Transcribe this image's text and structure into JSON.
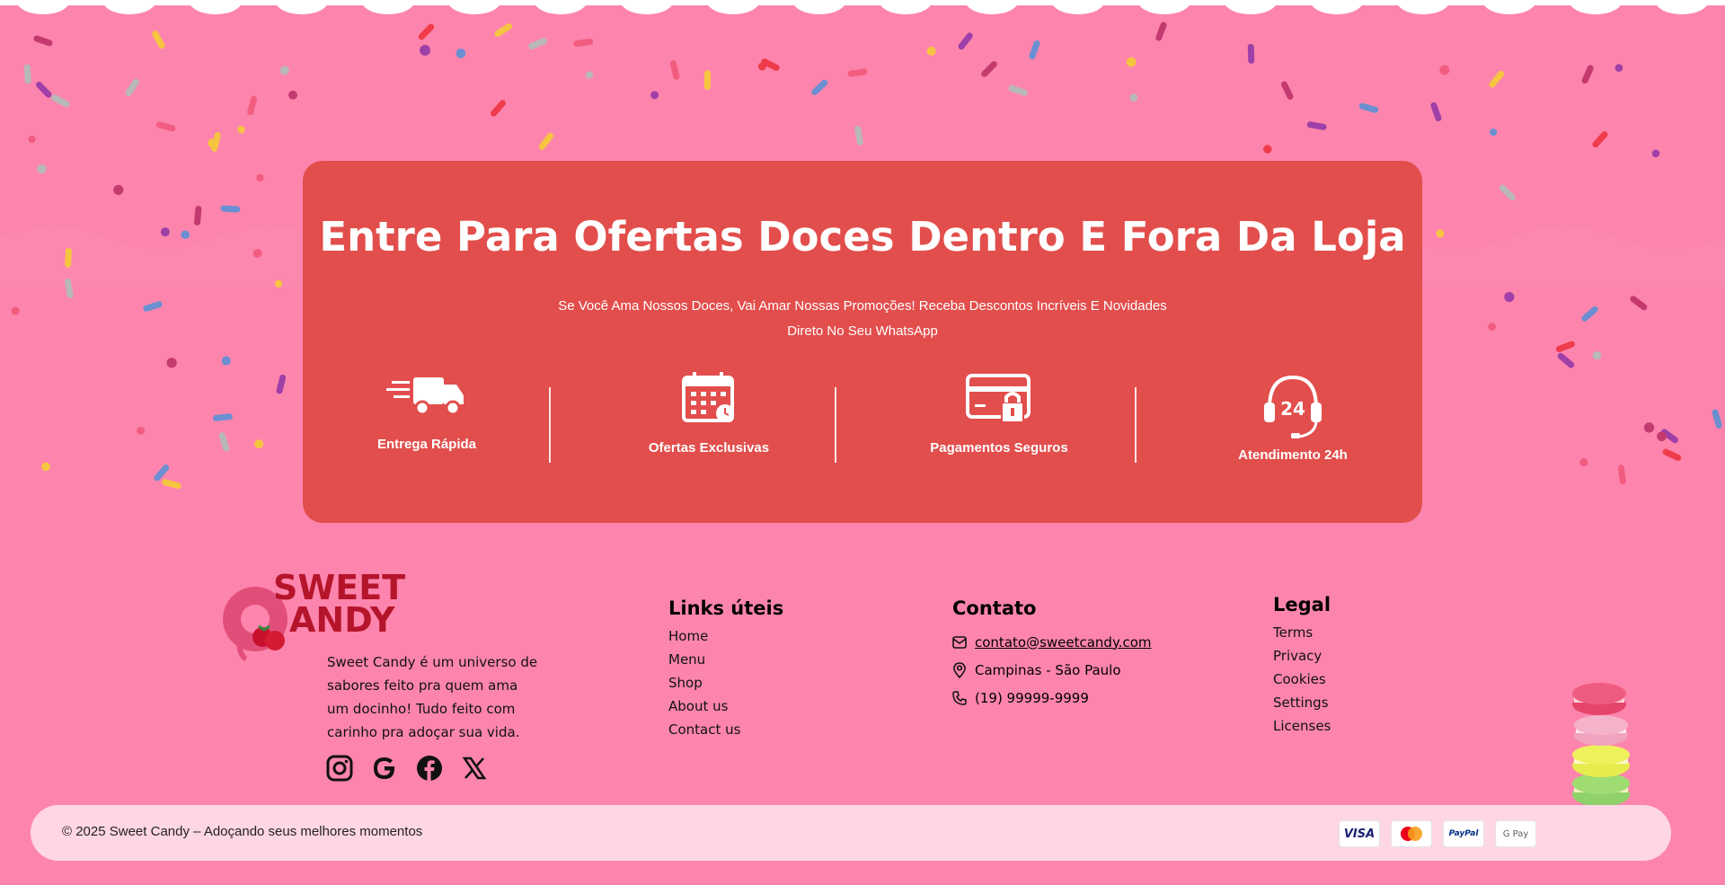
{
  "promo": {
    "title": "Entre Para Ofertas Doces Dentro E Fora Da Loja",
    "subtitle_line1": "Se Você Ama Nossos Doces, Vai Amar Nossas Promoções! Receba Descontos Incríveis E Novidades",
    "subtitle_line2": "Direto No Seu WhatsApp",
    "features": [
      {
        "label": "Entrega Rápida",
        "icon": "delivery-truck-icon"
      },
      {
        "label": "Ofertas Exclusivas",
        "icon": "calendar-clock-icon"
      },
      {
        "label": "Pagamentos Seguros",
        "icon": "secure-card-icon"
      },
      {
        "label": "Atendimento 24h",
        "icon": "headset-24h-icon"
      }
    ]
  },
  "brand": {
    "logo_line1": "SWEET",
    "logo_line2": "ANDY",
    "about": "Sweet Candy é um universo de sabores feito pra quem ama um docinho! Tudo feito com carinho pra adoçar sua vida.",
    "social_icons": [
      "instagram-icon",
      "google-icon",
      "facebook-icon",
      "x-icon"
    ]
  },
  "links": {
    "title": "Links úteis",
    "items": [
      "Home",
      "Menu",
      "Shop",
      "About us",
      "Contact us"
    ]
  },
  "contact": {
    "title": "Contato",
    "email": "contato@sweetcandy.com",
    "location": "Campinas - São Paulo",
    "phone": "(19) 99999-9999"
  },
  "legal": {
    "title": "Legal",
    "items": [
      "Terms",
      "Privacy",
      "Cookies",
      "Settings",
      "Licenses"
    ]
  },
  "bottom": {
    "copyright": "© 2025 Sweet Candy – Adoçando seus melhores momentos",
    "payments": [
      {
        "name": "visa",
        "label": "VISA",
        "color": "#1a1f71"
      },
      {
        "name": "mastercard",
        "label": "",
        "color": "#eb001b"
      },
      {
        "name": "paypal",
        "label": "PayPal",
        "color": "#003087"
      },
      {
        "name": "gpay",
        "label": "G Pay",
        "color": "#5f6368"
      }
    ]
  },
  "colors": {
    "background": "#fd85ad",
    "promo_box": "#e24e4c",
    "footer_bar": "#ffd6e5"
  }
}
